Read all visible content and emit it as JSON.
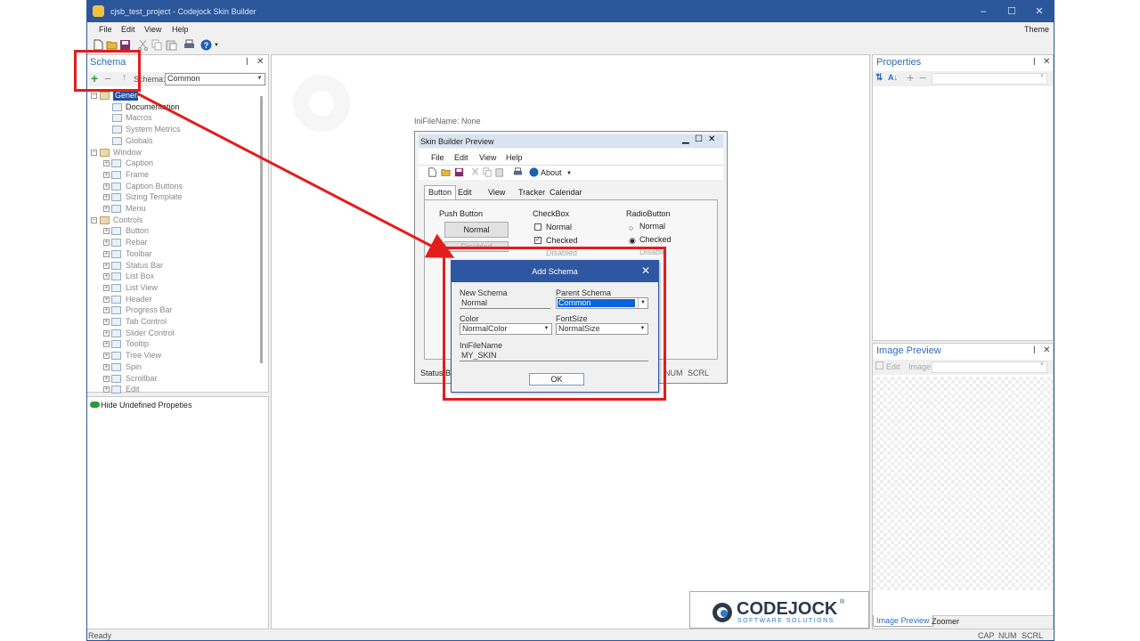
{
  "window": {
    "title": "cjsb_test_project - Codejock Skin Builder",
    "controls": [
      "–",
      "☐",
      "✕"
    ]
  },
  "menu": {
    "items": [
      "File",
      "Edit",
      "View",
      "Help"
    ],
    "theme": "Theme"
  },
  "schema_pane": {
    "title": "Schema",
    "schema_label": "Schema:",
    "schema_value": "Common",
    "tree": {
      "general": "General",
      "general_children": [
        "Documentation",
        "Macros",
        "System Metrics",
        "Globals"
      ],
      "window": "Window",
      "window_children": [
        "Caption",
        "Frame",
        "Caption Buttons",
        "Sizing Template",
        "Menu"
      ],
      "controls": "Controls",
      "controls_children": [
        "Button",
        "Rebar",
        "Toolbar",
        "Status Bar",
        "List Box",
        "List View",
        "Header",
        "Progress Bar",
        "Tab Control",
        "Slider Control",
        "Tooltip",
        "Tree View",
        "Spin",
        "Scrollbar",
        "Edit"
      ]
    },
    "hide_undefined": "Hide Undefined Propeties"
  },
  "center": {
    "inifile_label": "IniFileName: None",
    "preview": {
      "title": "Skin Builder Preview",
      "menu": [
        "File",
        "Edit",
        "View",
        "Help"
      ],
      "about": "About",
      "tabs": [
        "Button",
        "Edit",
        "View",
        "Tracker",
        "Calendar"
      ],
      "push_button": {
        "group": "Push Button",
        "normal": "Normal",
        "disabled": "Disabled"
      },
      "checkbox": {
        "group": "CheckBox",
        "normal": "Normal",
        "checked": "Checked",
        "disabled": "Disabled"
      },
      "radio": {
        "group": "RadioButton",
        "normal": "Normal",
        "checked": "Checked",
        "disabled": "Disable"
      },
      "status_text": "Status Ba",
      "status_indicators": [
        "NUM",
        "SCRL"
      ]
    },
    "dialog": {
      "title": "Add Schema",
      "new_schema_label": "New Schema",
      "new_schema_value": "Normal",
      "parent_schema_label": "Parent Schema",
      "parent_schema_value": "Common",
      "color_label": "Color",
      "color_value": "NormalColor",
      "fontsize_label": "FontSize",
      "fontsize_value": "NormalSize",
      "inifilename_label": "IniFileName",
      "inifilename_value": "MY_SKIN",
      "ok": "OK"
    },
    "logo": {
      "brand": "CODEJOCK",
      "tagline": "SOFTWARE SOLUTIONS",
      "trademark": "®"
    }
  },
  "properties_pane": {
    "title": "Properties"
  },
  "image_preview_pane": {
    "title": "Image Preview",
    "edit": "Edit",
    "image": "Image:",
    "tabs": [
      "Image Preview",
      "Zoomer"
    ]
  },
  "statusbar": {
    "ready": "Ready",
    "indicators": [
      "CAP",
      "NUM",
      "SCRL"
    ]
  },
  "colors": {
    "accent": "#2b579a",
    "annotation": "#e41c1c",
    "dialog_title": "#2f56a0",
    "header_text": "#2b6cc0"
  }
}
